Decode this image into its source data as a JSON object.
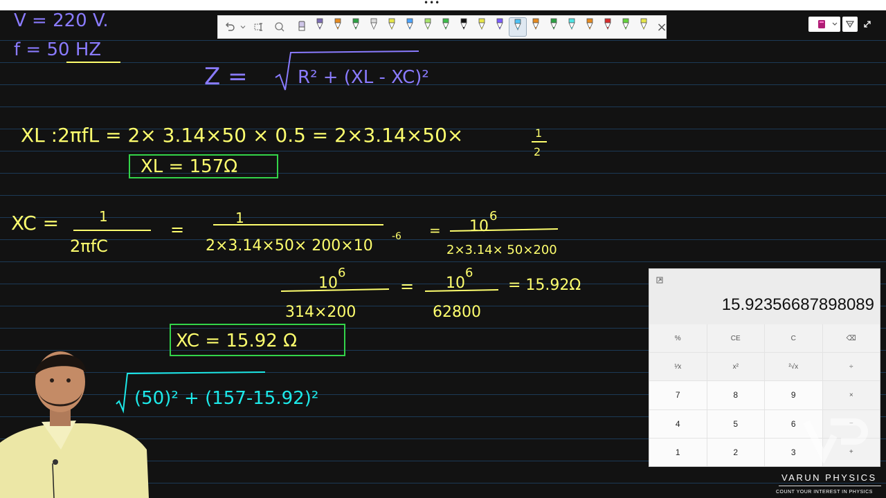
{
  "board": {
    "line_color": "#1c3a57",
    "ink_colors": {
      "purple": "#8a7bff",
      "yellow": "#ffff6e",
      "green": "#33d44a",
      "cyan": "#1de9e9",
      "white": "#ffffff"
    }
  },
  "toolbar": {
    "icons": [
      "undo-icon",
      "dropdown-icon",
      "text-select-icon",
      "lasso-icon",
      "eraser-icon"
    ],
    "pen_colors": [
      "#7b6cb3",
      "#e58a1f",
      "#2ea043",
      "#dcdcdc",
      "#e6e64a",
      "#4aa3ff",
      "#a6e36b",
      "#3dbb4a",
      "#111111",
      "#e8e64a",
      "#7a5cff",
      "#4fc3f7",
      "#e58a1f",
      "#2ea043",
      "#4fe3e3",
      "#e58a1f",
      "#d62d2d",
      "#64d23c",
      "#e6e64a"
    ],
    "selected_index": 11,
    "close_label": "×"
  },
  "right_controls": {
    "notebook_icon": "notebook-icon",
    "filter_icon": "filter-icon",
    "expand_icon": "expand-icon"
  },
  "handwriting": {
    "v": "V = 220 V.",
    "f": "f = 50 HZ",
    "z_lhs": "Z =",
    "z_rhs": "R² + (XL - XC)²",
    "xl_eq": "XL :2πfL = 2× 3.14×50 × 0.5 = 2×3.14×50×",
    "xl_frac_num": "1",
    "xl_frac_den": "2",
    "xl_result": "XL = 157Ω",
    "xc_lhs": "XC =",
    "xc_f1_num": "1",
    "xc_f1_den": "2πfC",
    "xc_eq1": "=",
    "xc_f2_num": "1",
    "xc_f2_den": "2×3.14×50× 200×10",
    "xc_f2_exp": "-6",
    "xc_eq2": "=",
    "xc_f3_num": "10",
    "xc_f3_exp": "6",
    "xc_f3_den": "2×3.14× 50×200",
    "xc_f4_num": "10",
    "xc_f4_exp": "6",
    "xc_f4_den": "314×200",
    "xc_eq3": "=",
    "xc_f5_num": "10",
    "xc_f5_exp": "6",
    "xc_f5_den": "62800",
    "xc_eq4": "= 15.92Ω",
    "xc_result": "XC = 15.92 Ω",
    "z_sub": "(50)² + (157-15.92)²"
  },
  "calculator": {
    "display": "15.92356687898089",
    "keys": [
      "%",
      "CE",
      "C",
      "⌫",
      "¹⁄x",
      "x²",
      "²√x",
      "÷",
      "7",
      "8",
      "9",
      "×",
      "4",
      "5",
      "6",
      "−",
      "1",
      "2",
      "3",
      "+"
    ]
  },
  "brand": {
    "title": "VARUN   PHYSICS",
    "tagline": "COUNT YOUR INTEREST IN PHYSICS"
  }
}
